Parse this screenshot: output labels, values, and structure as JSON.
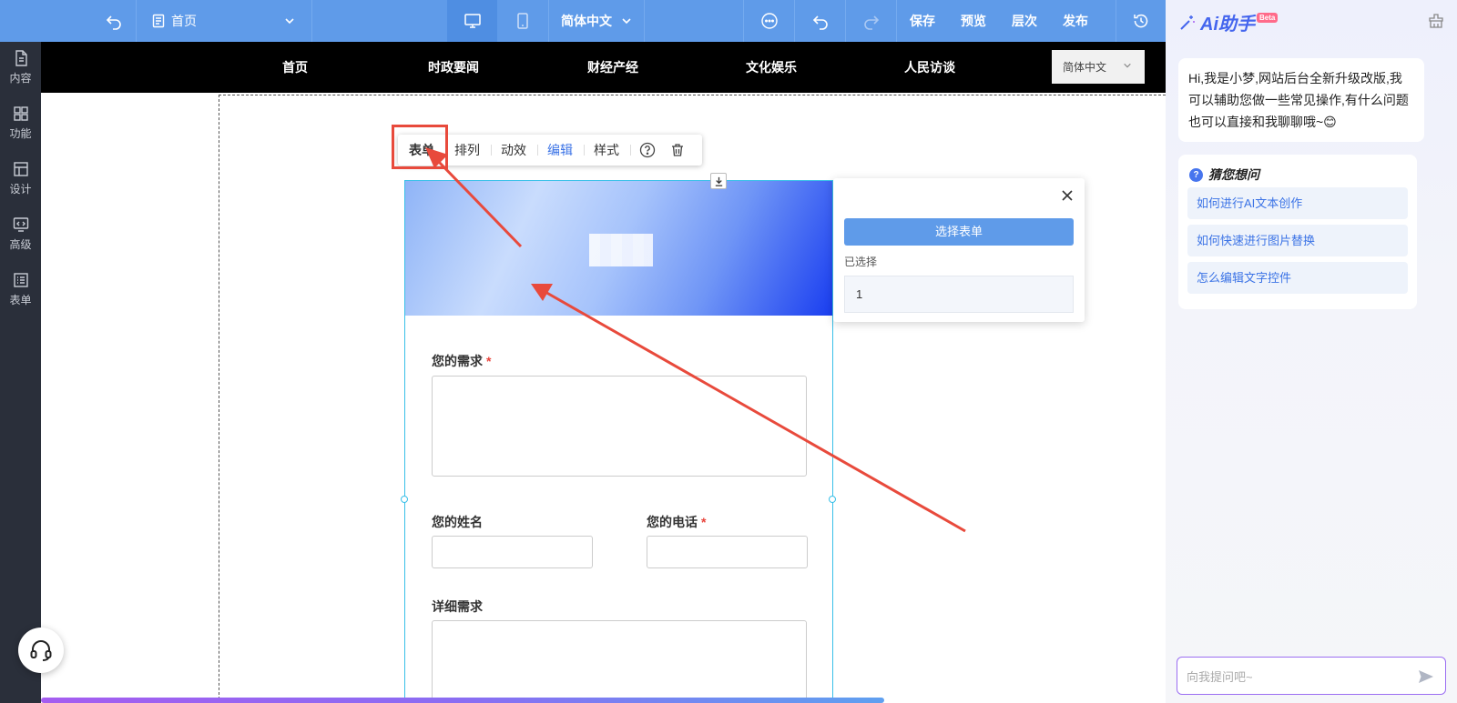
{
  "toolbar": {
    "page_name": "首页",
    "language": "简体中文",
    "save": "保存",
    "preview": "预览",
    "layers": "层次",
    "publish": "发布"
  },
  "sidebar": {
    "items": [
      {
        "label": "内容",
        "icon": "document-icon"
      },
      {
        "label": "功能",
        "icon": "grid-icon"
      },
      {
        "label": "设计",
        "icon": "layout-icon"
      },
      {
        "label": "高级",
        "icon": "code-monitor-icon"
      },
      {
        "label": "表单",
        "icon": "list-icon"
      }
    ]
  },
  "site_nav": {
    "links": [
      "首页",
      "时政要闻",
      "财经产经",
      "文化娱乐",
      "人民访谈"
    ],
    "language": "简体中文"
  },
  "mini_toolbar": {
    "form": "表单",
    "arrange": "排列",
    "animation": "动效",
    "edit": "编辑",
    "style": "样式"
  },
  "form": {
    "need_label": "您的需求",
    "name_label": "您的姓名",
    "phone_label": "您的电话",
    "detail_label": "详细需求",
    "required_mark": "*"
  },
  "form_popup": {
    "select_button": "选择表单",
    "selected_label": "已选择",
    "selected_value": "1"
  },
  "ai_panel": {
    "brand": "Ai助手",
    "beta": "Beta",
    "greeting": "Hi,我是小梦,网站后台全新升级改版,我可以辅助您做一些常见操作,有什么问题也可以直接和我聊聊哦~😊",
    "guess_title": "猜您想问",
    "questions": [
      "如何进行AI文本创作",
      "如何快速进行图片替换",
      "怎么编辑文字控件"
    ],
    "input_placeholder": "向我提问吧~"
  },
  "colors": {
    "toolbar_bg": "#5f9be9",
    "sidebar_bg": "#2a2f3a",
    "accent_blue": "#3b73e6",
    "annotation_red": "#e84a3c",
    "selection_cyan": "#39c0e8"
  }
}
